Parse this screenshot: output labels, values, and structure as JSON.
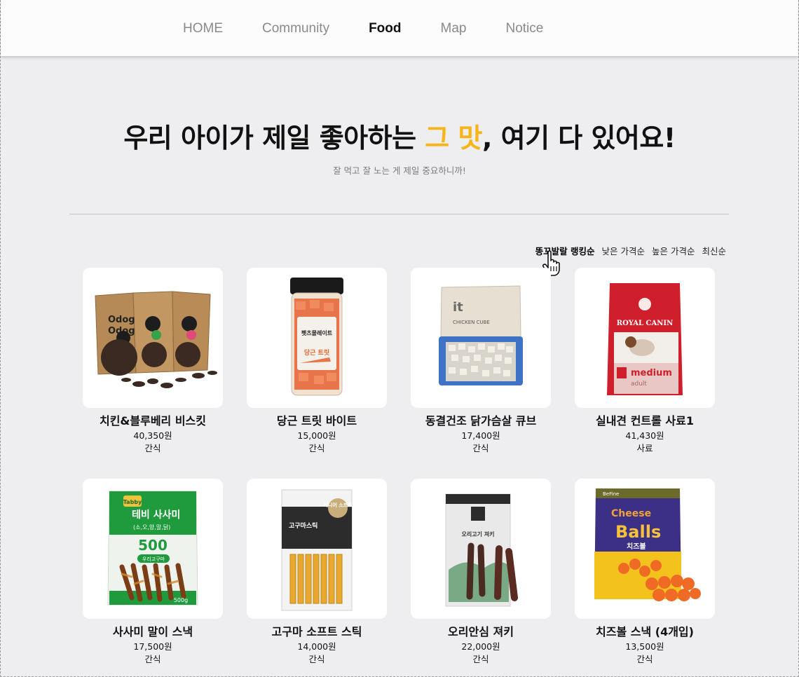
{
  "nav": {
    "items": [
      {
        "label": "HOME",
        "active": false
      },
      {
        "label": "Community",
        "active": false
      },
      {
        "label": "Food",
        "active": true
      },
      {
        "label": "Map",
        "active": false
      },
      {
        "label": "Notice",
        "active": false
      }
    ]
  },
  "hero": {
    "title_pre": "우리 아이가 제일 좋아하는 ",
    "title_highlight": "그 맛",
    "title_post": ", 여기 다 있어요!",
    "subtitle": "잘 먹고 잘 노는 게 제일 중요하니까!",
    "highlight_color": "#f7b518"
  },
  "sort": {
    "options": [
      "똥꼬발랄 랭킹순",
      "낮은 가격순",
      "높은 가격순",
      "최신순"
    ],
    "active_index": 0
  },
  "products": [
    {
      "name": "치킨&블루베리 비스킷",
      "price": "40,350원",
      "category": "간식",
      "image": "odog-biscuit-bags"
    },
    {
      "name": "당근 트릿 바이트",
      "price": "15,000원",
      "category": "간식",
      "image": "carrot-treat-jar"
    },
    {
      "name": "동결건조 닭가슴살 큐브",
      "price": "17,400원",
      "category": "간식",
      "image": "chicken-cube-bag"
    },
    {
      "name": "실내견 컨트롤 사료1",
      "price": "41,430원",
      "category": "사료",
      "image": "royal-canin-bag"
    },
    {
      "name": "사사미 말이 스낵",
      "price": "17,500원",
      "category": "간식",
      "image": "tabby-sasami-bag"
    },
    {
      "name": "고구마 소프트 스틱",
      "price": "14,000원",
      "category": "간식",
      "image": "sweetpotato-stick-pack"
    },
    {
      "name": "오리안심 져키",
      "price": "22,000원",
      "category": "간식",
      "image": "duck-jerky-pack"
    },
    {
      "name": "치즈볼 스낵 (4개입)",
      "price": "13,500원",
      "category": "간식",
      "image": "cheese-balls-bag"
    }
  ],
  "image_labels": {
    "odog": "Odog",
    "carrot_brand": "펫츠몰레이트",
    "carrot_label": "당근 트릿",
    "cube_brand": "it",
    "cube_label": "CHICKEN CUBE",
    "rc_brand": "ROYAL CANIN",
    "rc_line1": "medium",
    "rc_line2": "adult",
    "tabby_brand": "Tabby",
    "tabby_label": "테비 사사미",
    "tabby_sub": "(소,오,양,말,닭)",
    "tabby_num": "500",
    "tabby_tag": "우리고구마",
    "tabby_weight": "500g",
    "stick_label": "고구마스틱",
    "stick_badge": "시니어 소프트",
    "jerky_label": "오리고기 져키",
    "cheese_top": "Cheese",
    "cheese_main": "Balls",
    "cheese_ko": "치즈볼",
    "cheese_brand": "BeFine"
  }
}
